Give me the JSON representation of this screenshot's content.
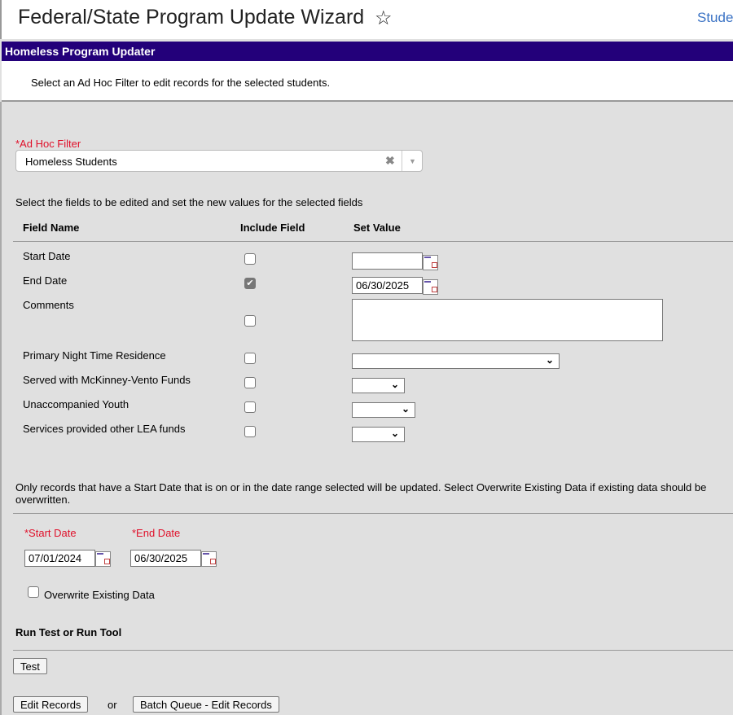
{
  "header": {
    "title": "Federal/State Program Update Wizard",
    "link": "Stude"
  },
  "panel": {
    "title": "Homeless Program Updater",
    "intro": "Select an Ad Hoc Filter to edit records for the selected students."
  },
  "ad_hoc": {
    "label": "*Ad Hoc Filter",
    "value": "Homeless Students"
  },
  "fields_instruction": "Select the fields to be edited and set the new values for the selected fields",
  "columns": [
    "Field Name",
    "Include Field",
    "Set Value"
  ],
  "fields": [
    {
      "name": "Start Date",
      "included": false,
      "value": ""
    },
    {
      "name": "End Date",
      "included": true,
      "value": "06/30/2025"
    },
    {
      "name": "Comments",
      "included": false,
      "value": ""
    },
    {
      "name": "Primary Night Time Residence",
      "included": false,
      "value": ""
    },
    {
      "name": "Served with McKinney-Vento Funds",
      "included": false,
      "value": ""
    },
    {
      "name": "Unaccompanied Youth",
      "included": false,
      "value": ""
    },
    {
      "name": "Services provided other LEA funds",
      "included": false,
      "value": ""
    }
  ],
  "range_note": "Only records that have a Start Date that is on or in the date range selected will be updated. Select Overwrite Existing Data if existing data should be overwritten.",
  "range": {
    "start_label": "*Start Date",
    "start": "07/01/2024",
    "end_label": "*End Date",
    "end": "06/30/2025",
    "overwrite_label": "Overwrite Existing Data",
    "overwrite": false
  },
  "run": {
    "heading": "Run Test or Run Tool",
    "test": "Test",
    "edit": "Edit Records",
    "or": "or",
    "batch": "Batch Queue - Edit Records"
  }
}
